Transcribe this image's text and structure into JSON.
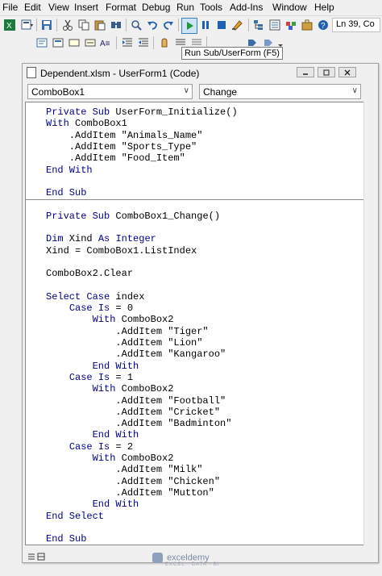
{
  "menubar": {
    "items": [
      "File",
      "Edit",
      "View",
      "Insert",
      "Format",
      "Debug",
      "Run",
      "Tools",
      "Add-Ins",
      "Window",
      "Help"
    ]
  },
  "status": {
    "position": "Ln 39, Co"
  },
  "tooltip": {
    "text": "Run Sub/UserForm (F5)"
  },
  "window": {
    "title": "Dependent.xlsm - UserForm1 (Code)"
  },
  "object_combo": {
    "value": "ComboBox1"
  },
  "procedure_combo": {
    "value": "Change"
  },
  "code": {
    "block1": [
      {
        "text": "Private Sub UserForm_Initialize()"
      },
      {
        "text": "With ComboBox1"
      },
      {
        "text": "    .AddItem \"Animals_Name\""
      },
      {
        "text": "    .AddItem \"Sports_Type\""
      },
      {
        "text": "    .AddItem \"Food_Item\""
      },
      {
        "text": "End With"
      },
      {
        "text": ""
      },
      {
        "text": "End Sub"
      }
    ],
    "block2": [
      {
        "text": "Private Sub ComboBox1_Change()"
      },
      {
        "text": ""
      },
      {
        "text": "Dim Xind As Integer"
      },
      {
        "text": "Xind = ComboBox1.ListIndex"
      },
      {
        "text": ""
      },
      {
        "text": "ComboBox2.Clear"
      },
      {
        "text": ""
      },
      {
        "text": "Select Case index"
      },
      {
        "text": "    Case Is = 0"
      },
      {
        "text": "        With ComboBox2"
      },
      {
        "text": "            .AddItem \"Tiger\""
      },
      {
        "text": "            .AddItem \"Lion\""
      },
      {
        "text": "            .AddItem \"Kangaroo\""
      },
      {
        "text": "        End With"
      },
      {
        "text": "    Case Is = 1"
      },
      {
        "text": "        With ComboBox2"
      },
      {
        "text": "            .AddItem \"Football\""
      },
      {
        "text": "            .AddItem \"Cricket\""
      },
      {
        "text": "            .AddItem \"Badminton\""
      },
      {
        "text": "        End With"
      },
      {
        "text": "    Case Is = 2"
      },
      {
        "text": "        With ComboBox2"
      },
      {
        "text": "            .AddItem \"Milk\""
      },
      {
        "text": "            .AddItem \"Chicken\""
      },
      {
        "text": "            .AddItem \"Mutton\""
      },
      {
        "text": "        End With"
      },
      {
        "text": "End Select"
      },
      {
        "text": ""
      },
      {
        "text": "End Sub"
      }
    ]
  },
  "watermark": {
    "brand": "exceldemy",
    "tagline": "EXCEL · DATA · BI"
  },
  "toolbar_icons": [
    "excel-icon",
    "insert-userform-icon",
    "save-icon",
    "cut-icon",
    "copy-icon",
    "paste-icon",
    "find-icon",
    "undo-icon",
    "redo-icon",
    "run-icon",
    "break-icon",
    "reset-icon",
    "design-mode-icon",
    "project-explorer-icon",
    "properties-icon",
    "object-browser-icon",
    "toolbox-icon",
    "help-icon"
  ]
}
